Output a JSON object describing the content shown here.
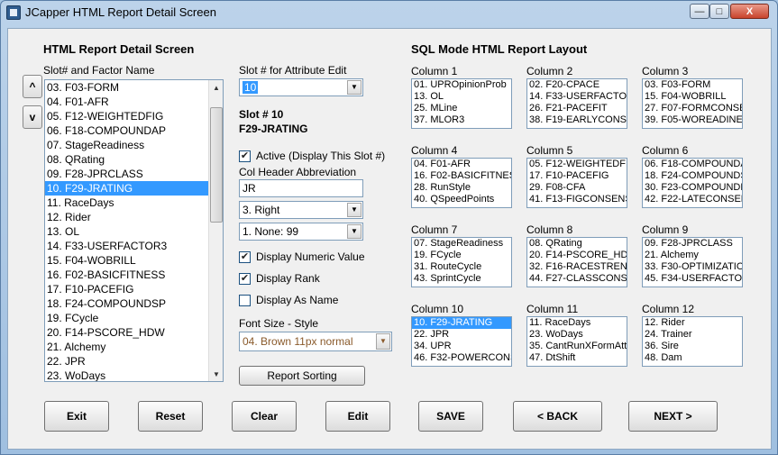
{
  "window": {
    "title": "JCapper HTML Report Detail Screen",
    "min_glyph": "—",
    "max_glyph": "□",
    "close_glyph": "X"
  },
  "left": {
    "heading": "HTML Report Detail Screen",
    "list_label": "Slot# and Factor Name",
    "up_label": "^",
    "down_label": "v",
    "items": [
      "03. F03-FORM",
      "04. F01-AFR",
      "05. F12-WEIGHTEDFIG",
      "06. F18-COMPOUNDAP",
      "07. StageReadiness",
      "08. QRating",
      "09. F28-JPRCLASS",
      "10. F29-JRATING",
      "11. RaceDays",
      "12. Rider",
      "13. OL",
      "14. F33-USERFACTOR3",
      "15. F04-WOBRILL",
      "16. F02-BASICFITNESS",
      "17. F10-PACEFIG",
      "18. F24-COMPOUNDSP",
      "19. FCycle",
      "20. F14-PSCORE_HDW",
      "21. Alchemy",
      "22. JPR",
      "23. WoDays"
    ],
    "selected_index": 7
  },
  "middle": {
    "slot_label": "Slot # for Attribute Edit",
    "slot_value": "10",
    "slot_heading": "Slot # 10",
    "slot_factor": "F29-JRATING",
    "active_label": "Active (Display This Slot #)",
    "active_checked": true,
    "col_header_label": "Col Header Abbreviation",
    "col_header_value": "JR",
    "align_value": "3. Right",
    "none_value": "1. None: 99",
    "display_numeric_label": "Display Numeric Value",
    "display_numeric_checked": true,
    "display_rank_label": "Display Rank",
    "display_rank_checked": true,
    "display_name_label": "Display As Name",
    "display_name_checked": false,
    "font_label": "Font Size - Style",
    "font_value": "04. Brown 11px normal",
    "report_sorting_label": "Report Sorting",
    "check_glyph": "✔"
  },
  "right": {
    "heading": "SQL Mode HTML Report Layout",
    "columns": [
      {
        "title": "Column 1",
        "items": [
          "01. UPROpinionProb",
          "13. OL",
          "25. MLine",
          "37. MLOR3"
        ],
        "sel": -1
      },
      {
        "title": "Column 2",
        "items": [
          "02. F20-CPACE",
          "14. F33-USERFACTOR",
          "26. F21-PACEFIT",
          "38. F19-EARLYCONSEN"
        ],
        "sel": -1
      },
      {
        "title": "Column 3",
        "items": [
          "03. F03-FORM",
          "15. F04-WOBRILL",
          "27. F07-FORMCONSEN",
          "39. F05-WOREADINES"
        ],
        "sel": -1
      },
      {
        "title": "Column 4",
        "items": [
          "04. F01-AFR",
          "16. F02-BASICFITNESS",
          "28. RunStyle",
          "40. QSpeedPoints"
        ],
        "sel": -1
      },
      {
        "title": "Column 5",
        "items": [
          "05. F12-WEIGHTEDFIG",
          "17. F10-PACEFIG",
          "29. F08-CFA",
          "41. F13-FIGCONSENSU"
        ],
        "sel": -1
      },
      {
        "title": "Column 6",
        "items": [
          "06. F18-COMPOUNDAP",
          "18. F24-COMPOUNDSP",
          "30. F23-COMPOUNDLA",
          "42. F22-LATECONSEN"
        ],
        "sel": -1
      },
      {
        "title": "Column 7",
        "items": [
          "07. StageReadiness",
          "19. FCycle",
          "31. RouteCycle",
          "43. SprintCycle"
        ],
        "sel": -1
      },
      {
        "title": "Column 8",
        "items": [
          "08. QRating",
          "20. F14-PSCORE_HDW",
          "32. F16-RACESTRENG",
          "44. F27-CLASSCONSE"
        ],
        "sel": -1
      },
      {
        "title": "Column 9",
        "items": [
          "09. F28-JPRCLASS",
          "21. Alchemy",
          "33. F30-OPTIMIZATIO",
          "45. F34-USERFACTOR"
        ],
        "sel": -1
      },
      {
        "title": "Column 10",
        "items": [
          "10. F29-JRATING",
          "22. JPR",
          "34. UPR",
          "46. F32-POWERCONSE"
        ],
        "sel": 0
      },
      {
        "title": "Column 11",
        "items": [
          "11. RaceDays",
          "23. WoDays",
          "35. CantRunXFormAttr",
          "47. DtShift"
        ],
        "sel": -1
      },
      {
        "title": "Column 12",
        "items": [
          "12. Rider",
          "24. Trainer",
          "36. Sire",
          "48. Dam"
        ],
        "sel": -1
      }
    ]
  },
  "buttons": {
    "exit": "Exit",
    "reset": "Reset",
    "clear": "Clear",
    "edit": "Edit",
    "save": "SAVE",
    "back": "< BACK",
    "next": "NEXT >"
  }
}
